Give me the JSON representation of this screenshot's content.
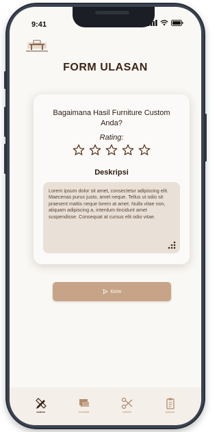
{
  "status": {
    "time": "9:41"
  },
  "logo": {
    "icon": "furniture-logo-icon"
  },
  "header": {
    "title": "FORM ULASAN"
  },
  "card": {
    "question": "Bagaimana Hasil Furniture Custom Anda?",
    "rating_label": "Rating:",
    "rating_value": 0,
    "rating_max": 5,
    "description_label": "Deskripsi",
    "description_text": "Lorem ipsum dolor sit amet, consectetur adipiscing elit. Maecenas purus justo, amet neque. Tellus ut odio sit praesent mattis neque lorem at amet. Nulla vitae non, aliquam adipiscing a, interdum tincidunt amet suspendisse. Consequat at cursus elit odio vitae."
  },
  "submit": {
    "label": "Kirim"
  },
  "tabs": [
    {
      "label": "custom",
      "icon": "pencil-ruler-icon",
      "active": true
    },
    {
      "label": "konsultasi",
      "icon": "chat-icon",
      "active": false
    },
    {
      "label": "material",
      "icon": "scissors-icon",
      "active": false
    },
    {
      "label": "pesanan",
      "icon": "clipboard-icon",
      "active": false
    }
  ],
  "colors": {
    "accent": "#c7a487",
    "title": "#3d2416",
    "field_bg": "#e9e1d7",
    "tab_bg": "#f4efe8",
    "star_stroke": "#5a3a22"
  }
}
